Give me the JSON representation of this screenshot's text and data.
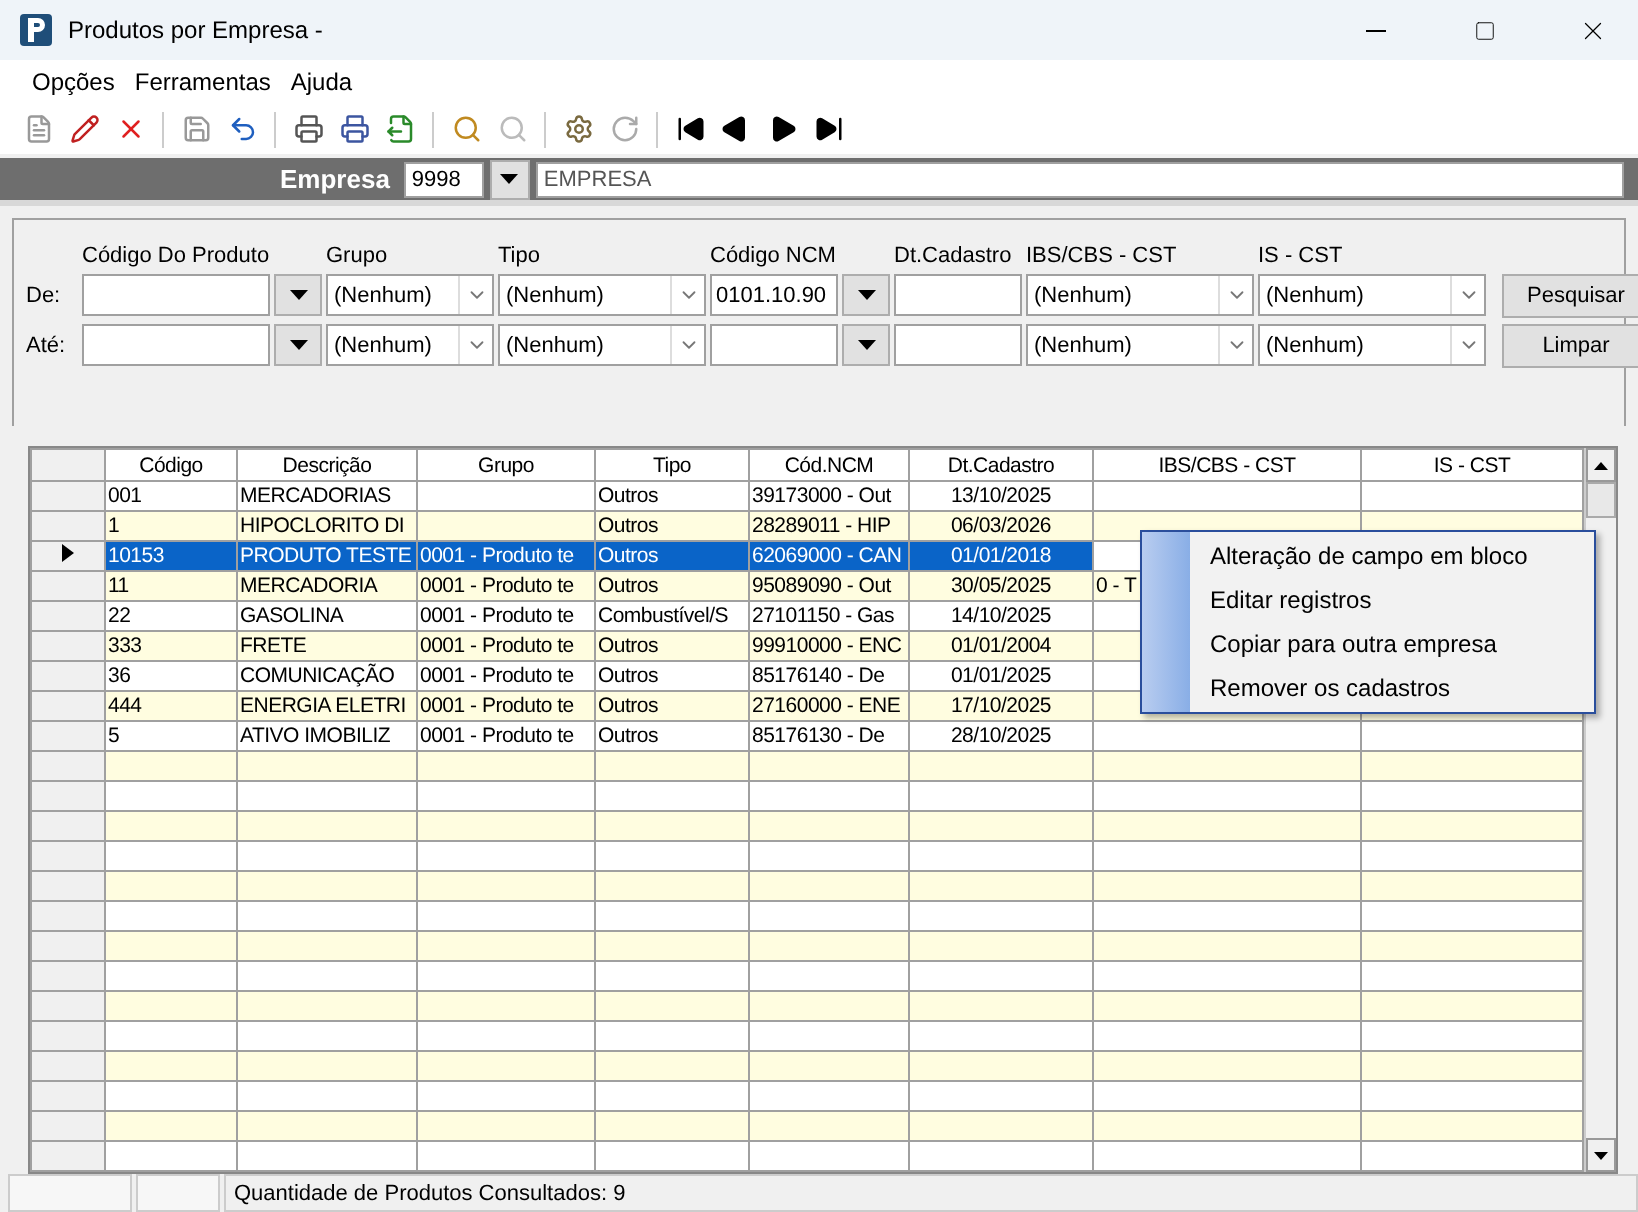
{
  "window": {
    "title": "Produtos por Empresa -"
  },
  "menu": [
    "Opções",
    "Ferramentas",
    "Ajuda"
  ],
  "empresa": {
    "label": "Empresa",
    "code": "9998",
    "name": "EMPRESA"
  },
  "filters": {
    "columns": [
      "Código Do Produto",
      "Grupo",
      "Tipo",
      "Código NCM",
      "Dt.Cadastro",
      "IBS/CBS - CST",
      "IS - CST"
    ],
    "rows": [
      {
        "label": "De:",
        "grupo": "(Nenhum)",
        "tipo": "(Nenhum)",
        "ncm": "0101.10.90",
        "ibs": "(Nenhum)",
        "is": "(Nenhum)"
      },
      {
        "label": "Até:",
        "grupo": "(Nenhum)",
        "tipo": "(Nenhum)",
        "ibs": "(Nenhum)",
        "is": "(Nenhum)"
      }
    ]
  },
  "buttons": [
    "Pesquisar",
    "Limpar"
  ],
  "table": {
    "columns": [
      "Código",
      "Descrição",
      "Grupo",
      "Tipo",
      "Cód.NCM",
      "Dt.Cadastro",
      "IBS/CBS - CST",
      "IS - CST"
    ],
    "rows": [
      {
        "selected": false,
        "cells": [
          "001",
          "MERCADORIAS",
          "",
          "Outros",
          "39173000 - Out",
          "13/10/2025",
          "",
          ""
        ]
      },
      {
        "selected": false,
        "cells": [
          "1",
          "HIPOCLORITO DI",
          "",
          "Outros",
          "28289011 - HIP",
          "06/03/2026",
          "",
          ""
        ]
      },
      {
        "selected": true,
        "cells": [
          "10153",
          "PRODUTO TESTE",
          "0001 - Produto te",
          "Outros",
          "62069000 - CAN",
          "01/01/2018",
          "",
          ""
        ]
      },
      {
        "selected": false,
        "cells": [
          "11",
          "MERCADORIA",
          "0001 - Produto te",
          "Outros",
          "95089090 - Out",
          "30/05/2025",
          "0 - T",
          ""
        ]
      },
      {
        "selected": false,
        "cells": [
          "22",
          "GASOLINA",
          "0001 - Produto te",
          "Combustível/S",
          "27101150 - Gas",
          "14/10/2025",
          "",
          ""
        ]
      },
      {
        "selected": false,
        "cells": [
          "333",
          "FRETE",
          "0001 - Produto te",
          "Outros",
          "99910000 - ENC",
          "01/01/2004",
          "",
          ""
        ]
      },
      {
        "selected": false,
        "cells": [
          "36",
          "COMUNICAÇÃO",
          "0001 - Produto te",
          "Outros",
          "85176140 - De",
          "01/01/2025",
          "",
          ""
        ]
      },
      {
        "selected": false,
        "cells": [
          "444",
          "ENERGIA ELETRI",
          "0001 - Produto te",
          "Outros",
          "27160000 - ENE",
          "17/10/2025",
          "",
          ""
        ]
      },
      {
        "selected": false,
        "cells": [
          "5",
          "ATIVO IMOBILIZ",
          "0001 - Produto te",
          "Outros",
          "85176130 - De",
          "28/10/2025",
          "",
          ""
        ]
      }
    ]
  },
  "context_menu": {
    "items": [
      "Alteração de campo em bloco",
      "Editar registros",
      "Copiar para outra empresa",
      "Remover os cadastros"
    ]
  },
  "status_bar": {
    "text": "Quantidade de Produtos Consultados: 9"
  }
}
